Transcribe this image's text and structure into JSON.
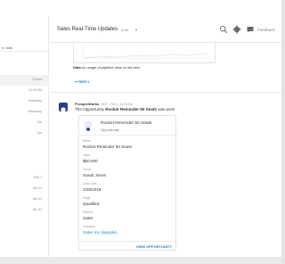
{
  "left_pane": {
    "subtitle": "n, bots",
    "dates_top": [
      "5 mins",
      "10:16 AM",
      "Yesterday",
      "Yesterday",
      "Tue",
      "Tue"
    ],
    "dates_bottom": [
      "Feb 1",
      "Jan 31",
      "Jan 31",
      "Jan 31"
    ]
  },
  "header": {
    "title": "Sales Real-Time Updates",
    "member_count": "Δ 16",
    "caret": "▾",
    "feedback_label": "Feedback",
    "icons": [
      "search-icon",
      "gear-icon",
      "feedback-icon"
    ]
  },
  "previous_message": {
    "caption_prefix": "Data",
    "caption_rest": " on usage of pipeline view vs list view",
    "reply_label": "REPLY"
  },
  "bot_message": {
    "sender": "ProsperWorks",
    "bot_tag": "BOT",
    "time": "Feb 3, 11:55 AM",
    "text_prefix": "The Opportunity ",
    "text_bold": "Rocket Reminder 50 Seats",
    "text_suffix": " was won!",
    "card": {
      "title": "Rocket Reminder 50 Seats",
      "type": "Opportunity",
      "fields": [
        {
          "label": "Name",
          "value": "Rocket Reminder 50 Seats"
        },
        {
          "label": "Value",
          "value": "$50,000"
        },
        {
          "label": "Owner",
          "value": "Sarah Jones"
        },
        {
          "label": "Close Date",
          "value": "1/29/2018"
        },
        {
          "label": "Stage",
          "value": "Qualified"
        },
        {
          "label": "Pipeline",
          "value": "Sales"
        },
        {
          "label": "Company",
          "value": "Sales Inc (sample)"
        }
      ],
      "action_label": "VIEW OPPORTUNITY"
    }
  },
  "colors": {
    "link": "#1e7fc9",
    "bot_avatar": "#2a3f8a"
  }
}
